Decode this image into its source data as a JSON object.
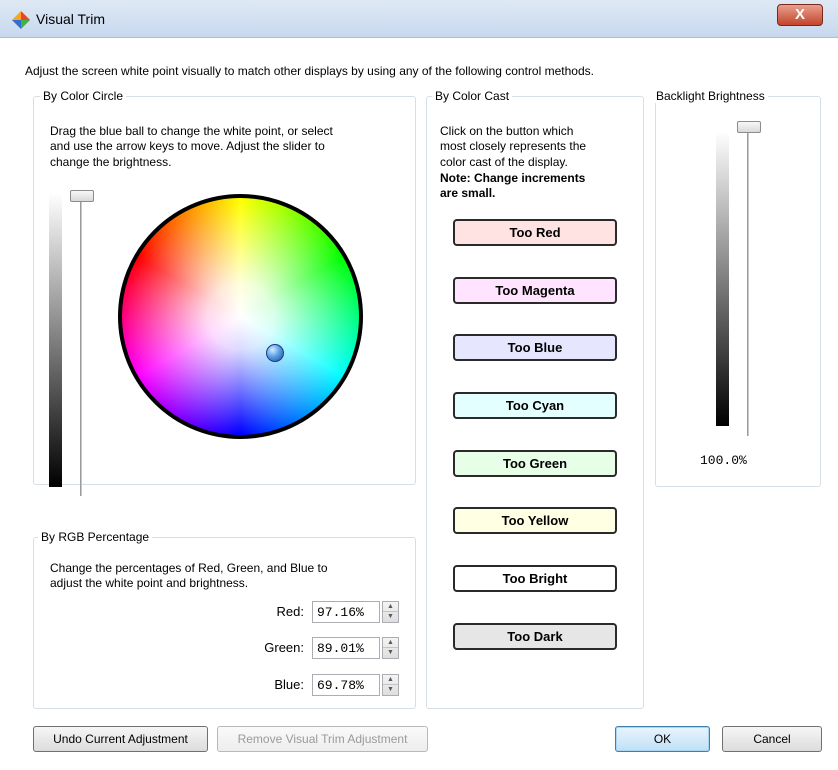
{
  "window": {
    "title": "Visual Trim",
    "close_label": "X"
  },
  "intro_text": "Adjust the screen white point visually to match other displays by using any of the following control methods.",
  "color_circle": {
    "group_label": "By Color Circle",
    "instructions_1": "Drag the blue ball to change the white point, or select",
    "instructions_2": "and use the arrow keys to move. Adjust the slider to",
    "instructions_3": "change the brightness."
  },
  "rgb_percentage": {
    "group_label": "By RGB Percentage",
    "instructions_1": "Change the percentages of Red, Green, and Blue to",
    "instructions_2": "adjust the white point and brightness.",
    "fields": [
      {
        "label": "Red:",
        "value": "97.16%"
      },
      {
        "label": "Green:",
        "value": "89.01%"
      },
      {
        "label": "Blue:",
        "value": "69.78%"
      }
    ]
  },
  "color_cast": {
    "group_label": "By Color Cast",
    "instructions_1": "Click on the button which",
    "instructions_2": "most closely represents the",
    "instructions_3": "color cast of the display.",
    "note_1": "Note: Change increments",
    "note_2": "are small.",
    "buttons": [
      {
        "label": "Too Red",
        "color": "#ffe3e3"
      },
      {
        "label": "Too Magenta",
        "color": "#ffe3ff"
      },
      {
        "label": "Too Blue",
        "color": "#e6e6ff"
      },
      {
        "label": "Too Cyan",
        "color": "#e3ffff"
      },
      {
        "label": "Too Green",
        "color": "#e6ffe6"
      },
      {
        "label": "Too Yellow",
        "color": "#ffffe3"
      },
      {
        "label": "Too Bright",
        "color": "#ffffff"
      },
      {
        "label": "Too Dark",
        "color": "#e6e6e6"
      }
    ]
  },
  "backlight": {
    "group_label": "Backlight Brightness",
    "value_text": "100.0%"
  },
  "footer": {
    "undo_label": "Undo Current Adjustment",
    "remove_label": "Remove Visual Trim Adjustment",
    "ok_label": "OK",
    "cancel_label": "Cancel"
  }
}
